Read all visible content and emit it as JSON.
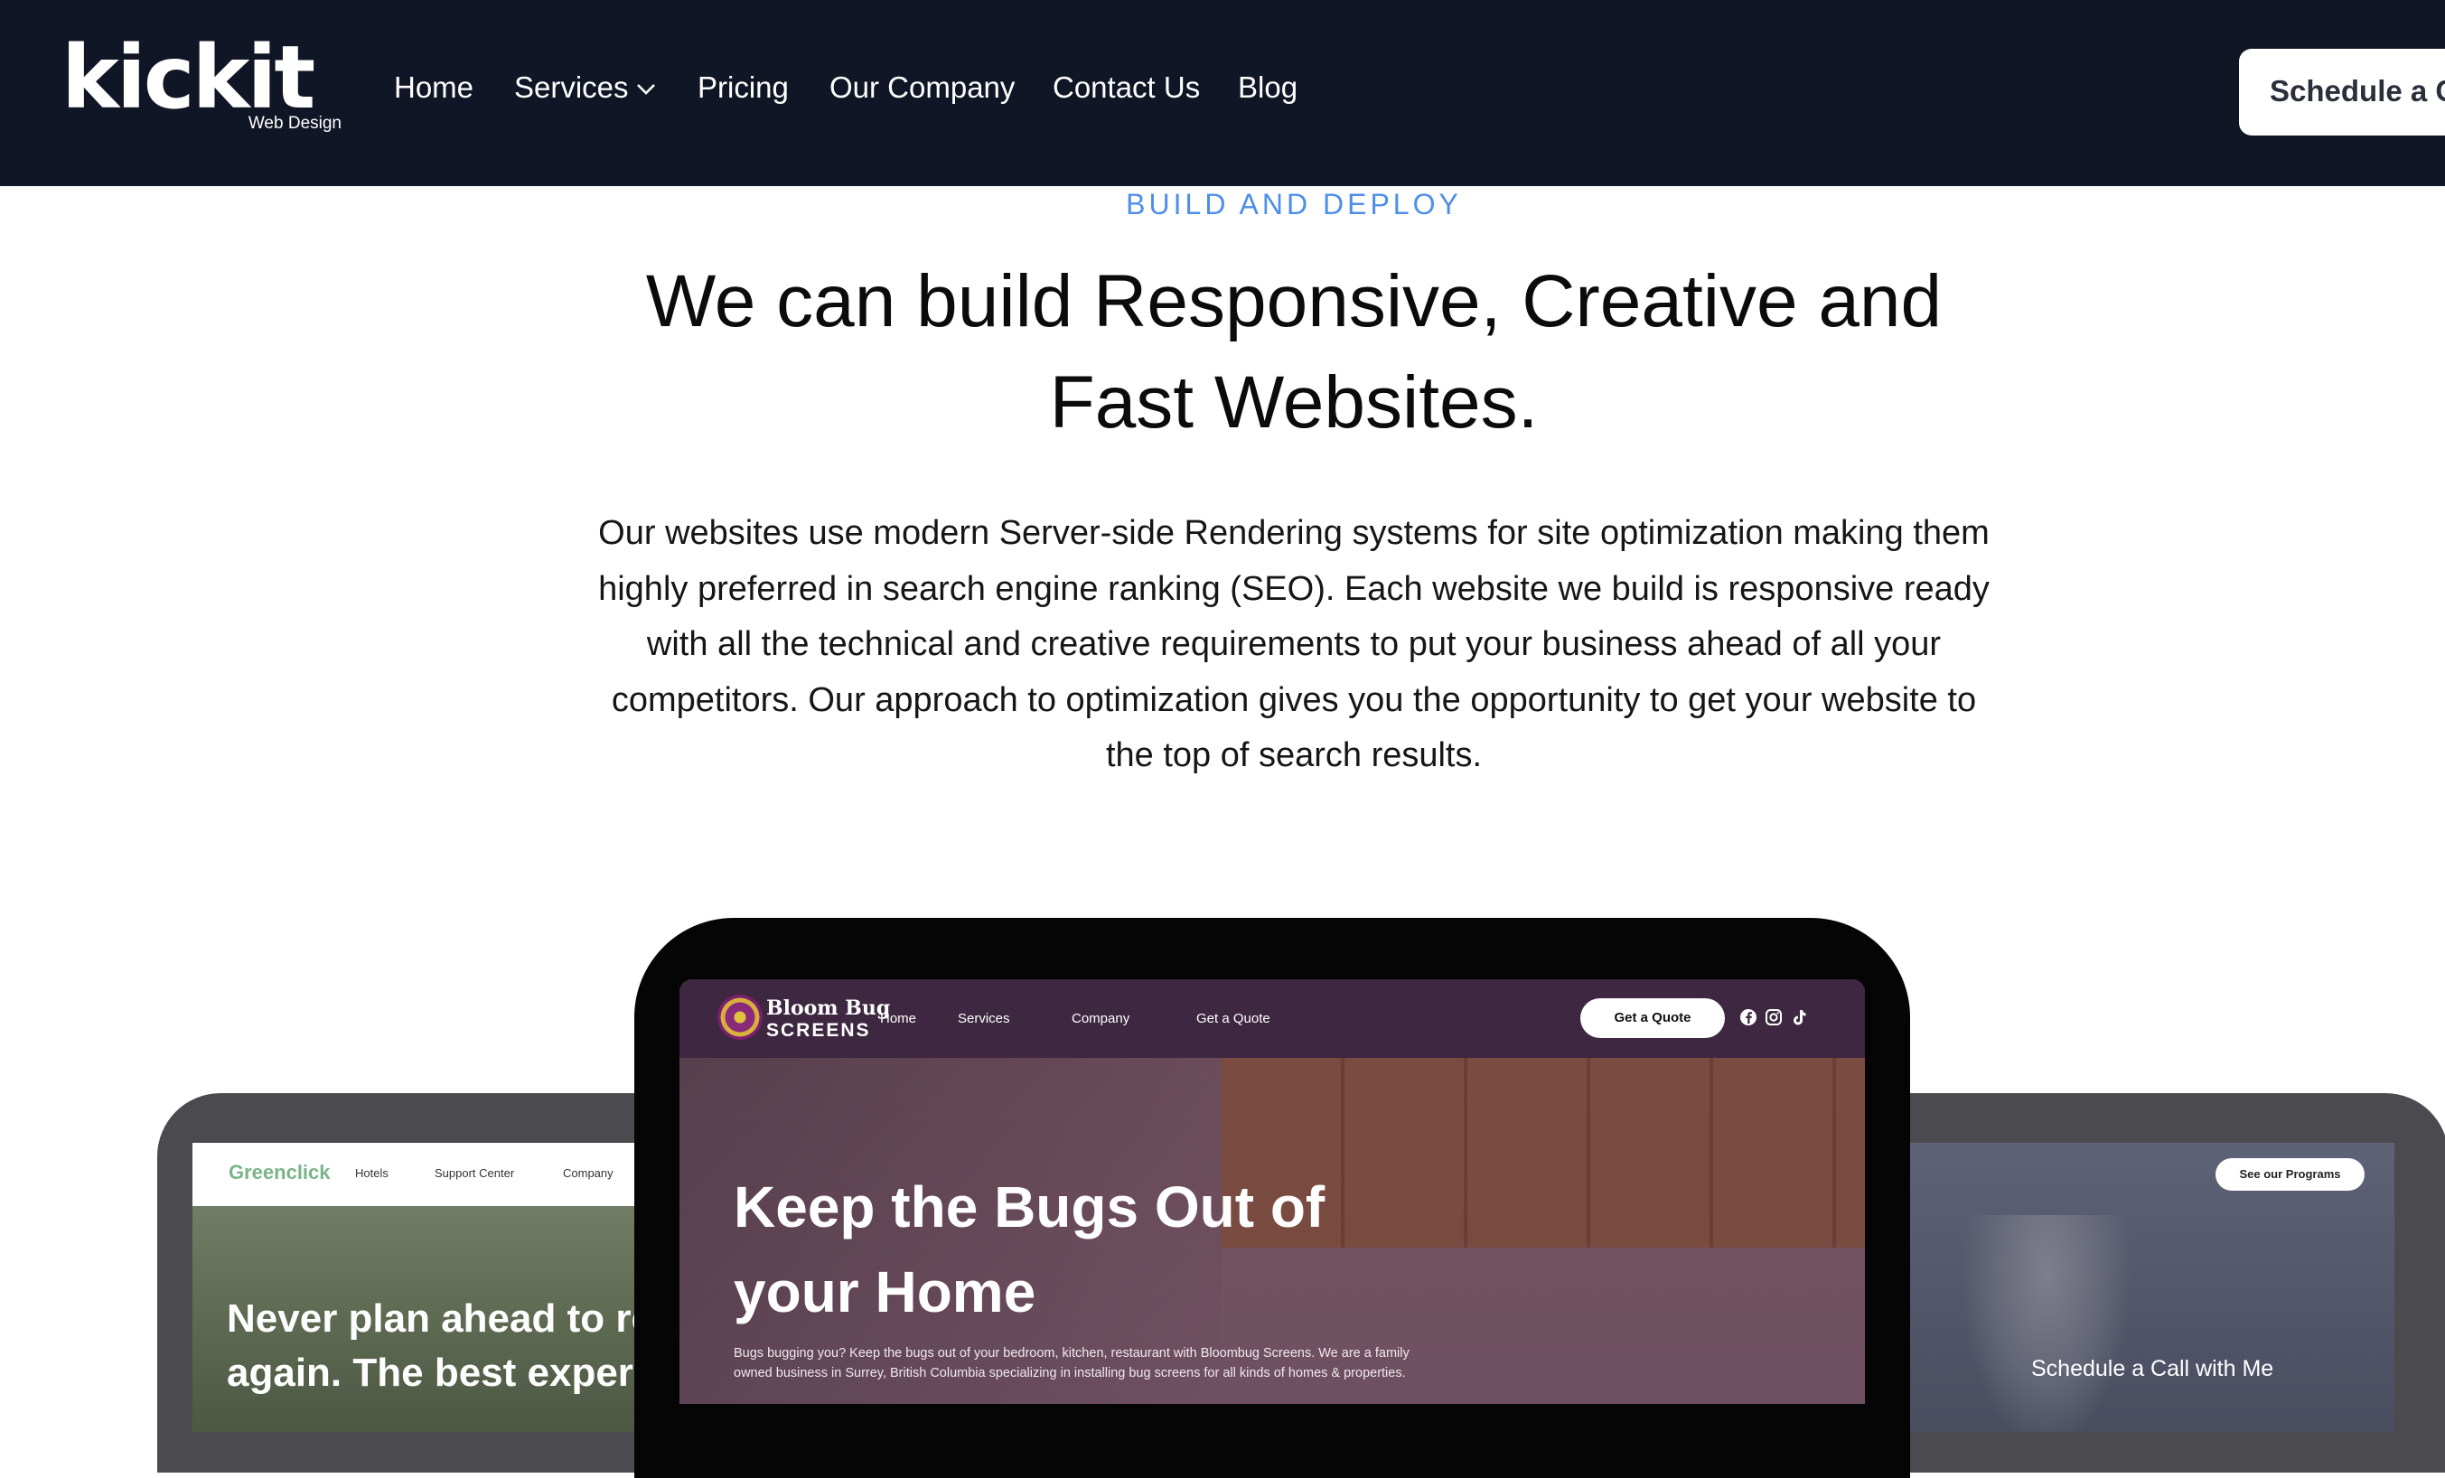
{
  "header": {
    "logo_word": "kickit",
    "logo_sub": "Web Design",
    "nav": [
      "Home",
      "Services",
      "Pricing",
      "Our Company",
      "Contact Us",
      "Blog"
    ],
    "cta_label": "Schedule a C"
  },
  "section": {
    "eyebrow": "BUILD AND DEPLOY",
    "headline_line1": "We can build Responsive, Creative and",
    "headline_line2": "Fast Websites.",
    "body": "Our websites use modern Server-side Rendering systems for site optimization making them highly preferred in search engine ranking (SEO). Each website we build is responsive ready with all the technical and creative requirements to put your business ahead of all your competitors. Our approach to optimization gives you the opportunity to get your website to the top of search results."
  },
  "mockup_left": {
    "logo": "Greenclick",
    "nav": [
      "Hotels",
      "Support Center",
      "Company"
    ],
    "hero_line1": "Never plan ahead to re",
    "hero_line2": "again. The best experi"
  },
  "mockup_center": {
    "logo_line1": "Bloom Bug",
    "logo_line2": "SCREENS",
    "nav": [
      "Home",
      "Services",
      "Company",
      "Get a Quote"
    ],
    "quote_button": "Get a Quote",
    "social_icons": [
      "facebook-icon",
      "instagram-icon",
      "tiktok-icon"
    ],
    "hero_line1": "Keep the Bugs Out of",
    "hero_line2": "your Home",
    "body": "Bugs bugging you? Keep the bugs out of your bedroom, kitchen, restaurant with Bloombug Screens. We are a family owned business in Surrey, British Columbia specializing in installing bug screens for all kinds of homes & properties."
  },
  "mockup_right": {
    "button": "See our Programs",
    "text": "Schedule a Call with Me"
  },
  "colors": {
    "header_bg": "#101625",
    "eyebrow": "#4d8ee8",
    "bloom_nav": "#3e2740"
  }
}
